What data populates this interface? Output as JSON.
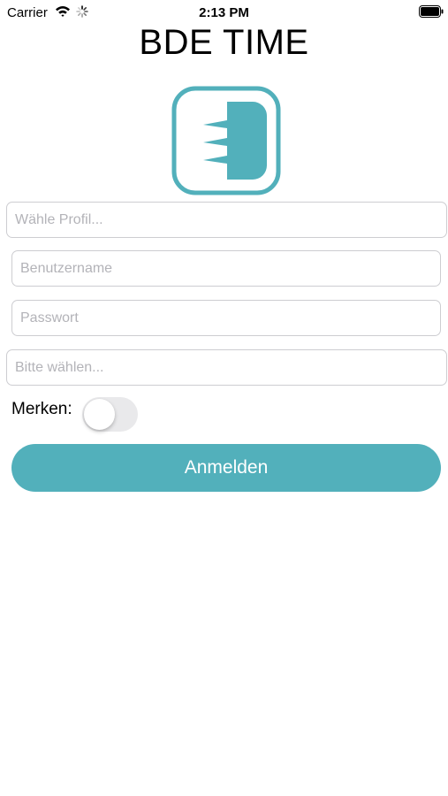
{
  "status_bar": {
    "carrier": "Carrier",
    "time": "2:13 PM",
    "icons": [
      "wifi-icon",
      "spinner-icon",
      "battery-icon"
    ]
  },
  "app": {
    "title": "BDE TIME",
    "logo": "bde-time-logo-icon",
    "accent_color": "#52b0bb"
  },
  "form": {
    "profile_placeholder": "Wähle Profil...",
    "username_placeholder": "Benutzername",
    "password_placeholder": "Passwort",
    "select_placeholder": "Bitte wählen...",
    "remember_label": "Merken:",
    "remember_checked": false,
    "login_label": "Anmelden"
  }
}
